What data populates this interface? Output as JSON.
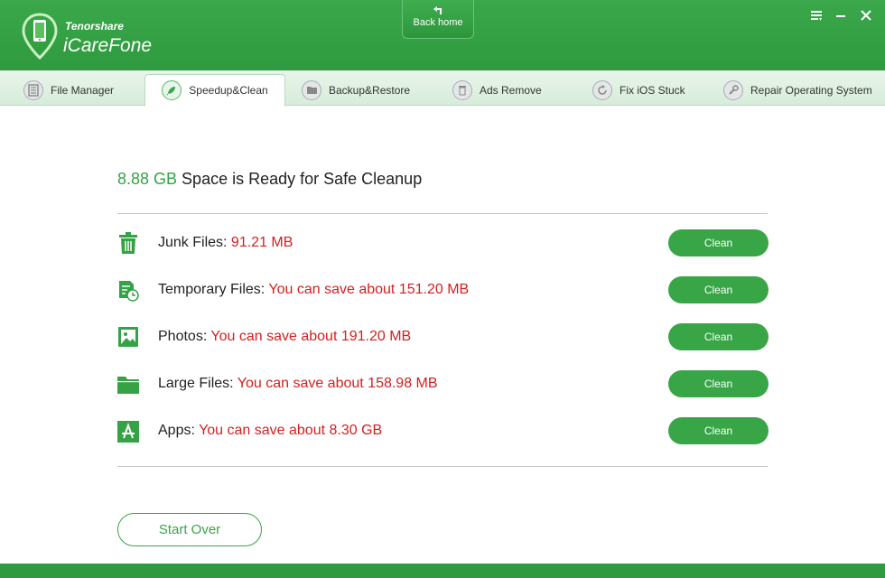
{
  "app": {
    "brand_small": "Tenorshare",
    "brand_name": "iCareFone",
    "back_home_label": "Back home"
  },
  "colors": {
    "accent": "#38a547",
    "value_red": "#d61e1e"
  },
  "tabs": [
    {
      "label": "File Manager",
      "icon": "file-manager-icon",
      "active": false
    },
    {
      "label": "Speedup&Clean",
      "icon": "rocket-icon",
      "active": true
    },
    {
      "label": "Backup&Restore",
      "icon": "folder-icon",
      "active": false
    },
    {
      "label": "Ads Remove",
      "icon": "trash-icon",
      "active": false
    },
    {
      "label": "Fix iOS Stuck",
      "icon": "refresh-icon",
      "active": false
    },
    {
      "label": "Repair Operating System",
      "icon": "wrench-icon",
      "active": false
    }
  ],
  "summary": {
    "size": "8.88 GB",
    "text": " Space is Ready for Safe Cleanup"
  },
  "items": [
    {
      "label": "Junk Files: ",
      "value": "91.21 MB",
      "icon": "trash-can-icon",
      "button": "Clean"
    },
    {
      "label": "Temporary Files: ",
      "value": "You can save about 151.20 MB",
      "icon": "temp-file-icon",
      "button": "Clean"
    },
    {
      "label": "Photos: ",
      "value": "You can save about 191.20 MB",
      "icon": "photo-icon",
      "button": "Clean"
    },
    {
      "label": "Large Files: ",
      "value": "You can save about 158.98 MB",
      "icon": "folder-icon",
      "button": "Clean"
    },
    {
      "label": "Apps: ",
      "value": "You can save about 8.30 GB",
      "icon": "app-store-icon",
      "button": "Clean"
    }
  ],
  "start_over_label": "Start Over"
}
